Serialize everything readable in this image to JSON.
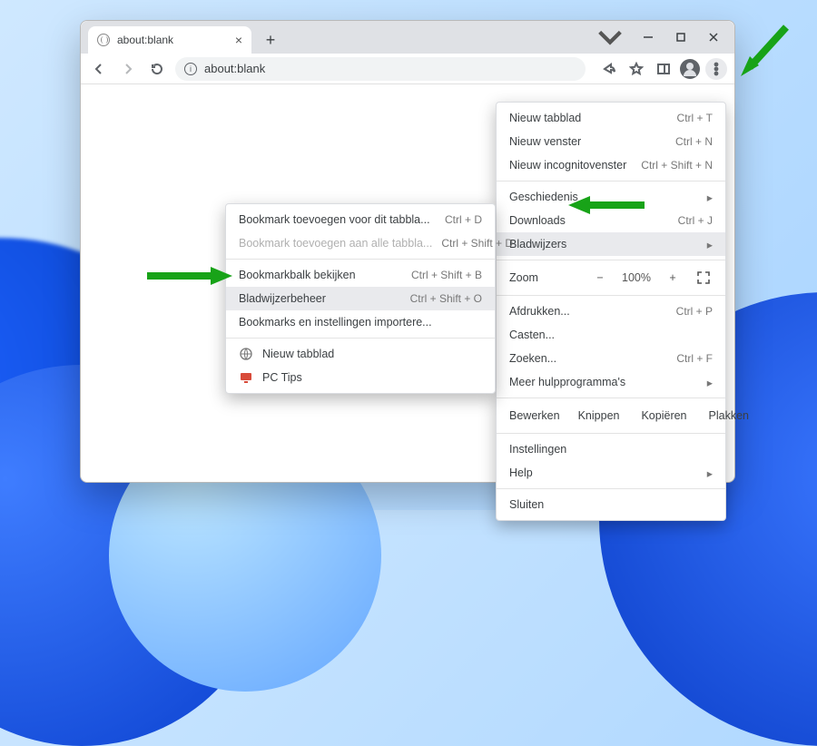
{
  "tab": {
    "title": "about:blank"
  },
  "omnibox": {
    "url": "about:blank"
  },
  "main_menu": {
    "new_tab": {
      "label": "Nieuw tabblad",
      "shortcut": "Ctrl + T"
    },
    "new_window": {
      "label": "Nieuw venster",
      "shortcut": "Ctrl + N"
    },
    "new_incognito": {
      "label": "Nieuw incognitovenster",
      "shortcut": "Ctrl + Shift + N"
    },
    "history": {
      "label": "Geschiedenis"
    },
    "downloads": {
      "label": "Downloads",
      "shortcut": "Ctrl + J"
    },
    "bookmarks": {
      "label": "Bladwijzers"
    },
    "zoom_label": "Zoom",
    "zoom_minus": "−",
    "zoom_value": "100%",
    "zoom_plus": "+",
    "print": {
      "label": "Afdrukken...",
      "shortcut": "Ctrl + P"
    },
    "cast": {
      "label": "Casten..."
    },
    "find": {
      "label": "Zoeken...",
      "shortcut": "Ctrl + F"
    },
    "more_tools": {
      "label": "Meer hulpprogramma's"
    },
    "edit_label": "Bewerken",
    "cut": "Knippen",
    "copy": "Kopiëren",
    "paste": "Plakken",
    "settings": {
      "label": "Instellingen"
    },
    "help": {
      "label": "Help"
    },
    "exit": {
      "label": "Sluiten"
    }
  },
  "bookmarks_submenu": {
    "add_page": {
      "label": "Bookmark toevoegen voor dit tabbla...",
      "shortcut": "Ctrl + D"
    },
    "add_all": {
      "label": "Bookmark toevoegen aan alle tabbla...",
      "shortcut": "Ctrl + Shift + D"
    },
    "show_bar": {
      "label": "Bookmarkbalk bekijken",
      "shortcut": "Ctrl + Shift + B"
    },
    "manager": {
      "label": "Bladwijzerbeheer",
      "shortcut": "Ctrl + Shift + O"
    },
    "import": {
      "label": "Bookmarks en instellingen importere..."
    },
    "bm_newtab": {
      "label": "Nieuw tabblad"
    },
    "bm_pctips": {
      "label": "PC Tips"
    }
  }
}
